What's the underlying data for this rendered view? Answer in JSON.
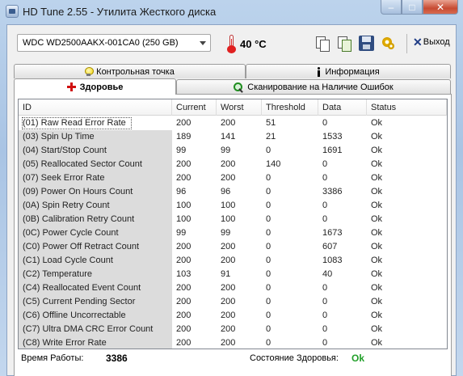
{
  "window": {
    "title": "HD Tune 2.55 - Утилита Жесткого диска",
    "min": "–",
    "max": "□",
    "close": "✕"
  },
  "toolbar": {
    "drive": "WDC WD2500AAKX-001CA0 (250 GB)",
    "temperature": "40 °C",
    "icons": [
      "copy-info-icon",
      "copy-screenshot-icon",
      "save-icon",
      "options-icon"
    ],
    "exit_label": "Выход"
  },
  "tabs": {
    "checkpoint": "Контрольная точка",
    "info": "Информация",
    "health": "Здоровье",
    "scan": "Сканирование на Наличие Ошибок"
  },
  "table": {
    "columns": [
      "ID",
      "Current",
      "Worst",
      "Threshold",
      "Data",
      "Status"
    ],
    "rows": [
      [
        "(01) Raw Read Error Rate",
        "200",
        "200",
        "51",
        "0",
        "Ok"
      ],
      [
        "(03) Spin Up Time",
        "189",
        "141",
        "21",
        "1533",
        "Ok"
      ],
      [
        "(04) Start/Stop Count",
        "99",
        "99",
        "0",
        "1691",
        "Ok"
      ],
      [
        "(05) Reallocated Sector Count",
        "200",
        "200",
        "140",
        "0",
        "Ok"
      ],
      [
        "(07) Seek Error Rate",
        "200",
        "200",
        "0",
        "0",
        "Ok"
      ],
      [
        "(09) Power On Hours Count",
        "96",
        "96",
        "0",
        "3386",
        "Ok"
      ],
      [
        "(0A) Spin Retry Count",
        "100",
        "100",
        "0",
        "0",
        "Ok"
      ],
      [
        "(0B) Calibration Retry Count",
        "100",
        "100",
        "0",
        "0",
        "Ok"
      ],
      [
        "(0C) Power Cycle Count",
        "99",
        "99",
        "0",
        "1673",
        "Ok"
      ],
      [
        "(C0) Power Off Retract Count",
        "200",
        "200",
        "0",
        "607",
        "Ok"
      ],
      [
        "(C1) Load Cycle Count",
        "200",
        "200",
        "0",
        "1083",
        "Ok"
      ],
      [
        "(C2) Temperature",
        "103",
        "91",
        "0",
        "40",
        "Ok"
      ],
      [
        "(C4) Reallocated Event Count",
        "200",
        "200",
        "0",
        "0",
        "Ok"
      ],
      [
        "(C5) Current Pending Sector",
        "200",
        "200",
        "0",
        "0",
        "Ok"
      ],
      [
        "(C6) Offline Uncorrectable",
        "200",
        "200",
        "0",
        "0",
        "Ok"
      ],
      [
        "(C7) Ultra DMA CRC Error Count",
        "200",
        "200",
        "0",
        "0",
        "Ok"
      ],
      [
        "(C8) Write Error Rate",
        "200",
        "200",
        "0",
        "0",
        "Ok"
      ]
    ]
  },
  "status": {
    "uptime_label": "Время Работы:",
    "uptime_value": "3386",
    "health_label": "Состояние Здоровья:",
    "health_value": "Ok"
  }
}
